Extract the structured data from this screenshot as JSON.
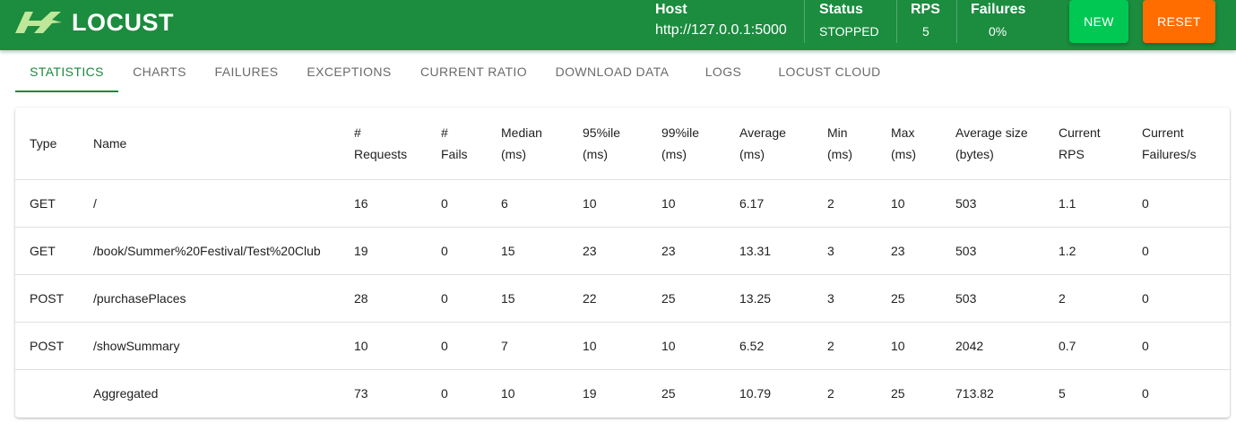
{
  "header": {
    "logo_text": "LOCUST",
    "host_label": "Host",
    "host_value": "http://127.0.0.1:5000",
    "status_label": "Status",
    "status_value": "STOPPED",
    "rps_label": "RPS",
    "rps_value": "5",
    "failures_label": "Failures",
    "failures_value": "0%",
    "new_button": "NEW",
    "reset_button": "RESET"
  },
  "tabs": [
    {
      "label": "STATISTICS",
      "active": true
    },
    {
      "label": "CHARTS"
    },
    {
      "label": "FAILURES"
    },
    {
      "label": "EXCEPTIONS"
    },
    {
      "label": "CURRENT RATIO"
    },
    {
      "label": "DOWNLOAD DATA"
    },
    {
      "label": "LOGS"
    },
    {
      "label": "LOCUST CLOUD"
    }
  ],
  "table": {
    "headers": [
      [
        "Type"
      ],
      [
        "Name"
      ],
      [
        "#",
        "Requests"
      ],
      [
        "#",
        "Fails"
      ],
      [
        "Median",
        "(ms)"
      ],
      [
        "95%ile",
        "(ms)"
      ],
      [
        "99%ile",
        "(ms)"
      ],
      [
        "Average",
        "(ms)"
      ],
      [
        "Min",
        "(ms)"
      ],
      [
        "Max",
        "(ms)"
      ],
      [
        "Average size",
        "(bytes)"
      ],
      [
        "Current",
        "RPS"
      ],
      [
        "Current",
        "Failures/s"
      ]
    ],
    "rows": [
      [
        "GET",
        "/",
        "16",
        "0",
        "6",
        "10",
        "10",
        "6.17",
        "2",
        "10",
        "503",
        "1.1",
        "0"
      ],
      [
        "GET",
        "/book/Summer%20Festival/Test%20Club",
        "19",
        "0",
        "15",
        "23",
        "23",
        "13.31",
        "3",
        "23",
        "503",
        "1.2",
        "0"
      ],
      [
        "POST",
        "/purchasePlaces",
        "28",
        "0",
        "15",
        "22",
        "25",
        "13.25",
        "3",
        "25",
        "503",
        "2",
        "0"
      ],
      [
        "POST",
        "/showSummary",
        "10",
        "0",
        "7",
        "10",
        "10",
        "6.52",
        "2",
        "10",
        "2042",
        "0.7",
        "0"
      ],
      [
        "",
        "Aggregated",
        "73",
        "0",
        "10",
        "19",
        "25",
        "10.79",
        "2",
        "25",
        "713.82",
        "5",
        "0"
      ]
    ]
  },
  "colors": {
    "header_bg": "#1c8c3f",
    "new_button": "#00c853",
    "reset_button": "#ff6d00",
    "active_tab": "#1a8a3d"
  }
}
